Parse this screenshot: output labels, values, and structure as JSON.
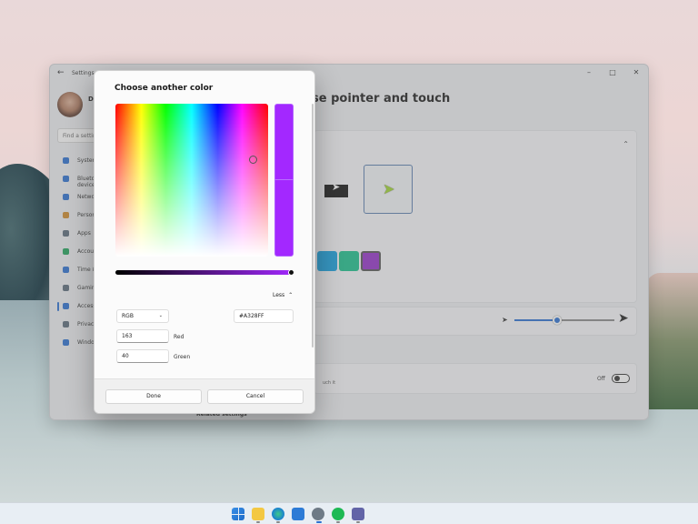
{
  "settings": {
    "app_name": "Settings",
    "back_glyph": "←",
    "user_initial": "D",
    "search_placeholder": "Find a setting",
    "window_controls": [
      "–",
      "□",
      "✕"
    ],
    "nav": [
      {
        "label": "System",
        "icon": "monitor-icon",
        "color": "#2a6fd1"
      },
      {
        "label": "Bluetooth & devices",
        "icon": "bluetooth-icon",
        "color": "#2a6fd1"
      },
      {
        "label": "Network & internet",
        "icon": "wifi-icon",
        "color": "#2a6fd1"
      },
      {
        "label": "Personalization",
        "icon": "brush-icon",
        "color": "#d08a2a"
      },
      {
        "label": "Apps",
        "icon": "apps-icon",
        "color": "#5a6a7a"
      },
      {
        "label": "Accounts",
        "icon": "person-icon",
        "color": "#1fa35a"
      },
      {
        "label": "Time & language",
        "icon": "globe-icon",
        "color": "#2a6fd1"
      },
      {
        "label": "Gaming",
        "icon": "controller-icon",
        "color": "#5a6a7a"
      },
      {
        "label": "Accessibility",
        "icon": "accessibility-icon",
        "color": "#2a6fd1"
      },
      {
        "label": "Privacy & security",
        "icon": "shield-icon",
        "color": "#5a6a7a"
      },
      {
        "label": "Windows Update",
        "icon": "update-icon",
        "color": "#2a6fd1"
      }
    ],
    "page_title": "se pointer and touch",
    "touch_desc": "uch it",
    "toggle_label": "Off",
    "related_label": "Related settings",
    "pointer_swatches": [
      "#11a0e0",
      "#19c08c",
      "#9431c9"
    ]
  },
  "dialog": {
    "title": "Choose another color",
    "selected_color": "#A328FF",
    "less_label": "Less",
    "mode": "RGB",
    "hex_value": "#A328FF",
    "red_value": "163",
    "red_label": "Red",
    "green_value": "40",
    "green_label": "Green",
    "done_label": "Done",
    "cancel_label": "Cancel"
  },
  "taskbar": {
    "icons": [
      "windows-start-icon",
      "file-explorer-icon",
      "edge-icon",
      "store-icon",
      "settings-icon",
      "spotify-icon",
      "teams-icon"
    ]
  }
}
